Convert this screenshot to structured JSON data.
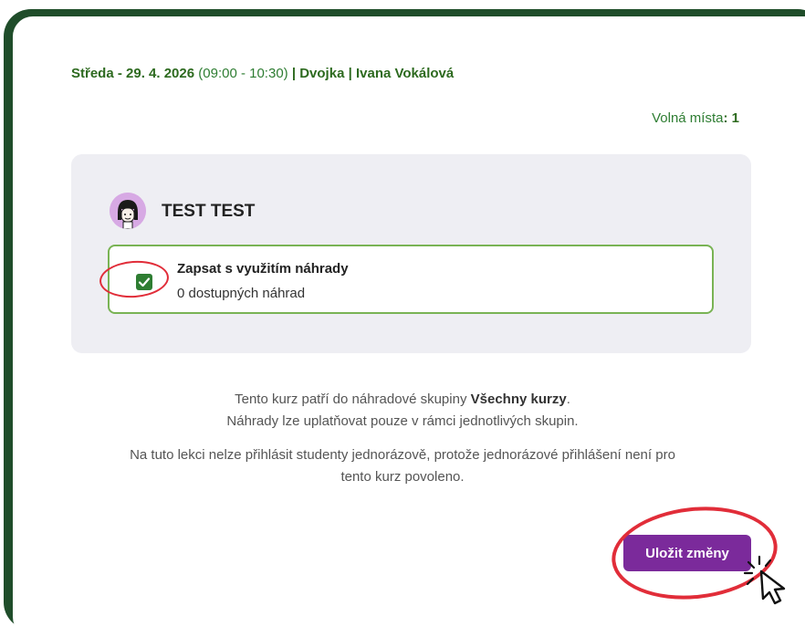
{
  "header": {
    "day_date": "Středa - 29. 4. 2026",
    "time": "(09:00 - 10:30)",
    "separator": "|",
    "group": "Dvojka",
    "teacher": "Ivana Vokálová"
  },
  "spots": {
    "label": "Volná místa",
    "colon": ":",
    "value": "1"
  },
  "student": {
    "name": "TEST TEST",
    "avatar_icon": "avatar-icon"
  },
  "option": {
    "checked": true,
    "title": "Zapsat s využitím náhrady",
    "subtitle": "0 dostupných náhrad",
    "checkbox_icon": "check-icon"
  },
  "info": {
    "line1_prefix": "Tento kurz patří do náhradové skupiny",
    "line1_group": "Všechny kurzy",
    "line1_suffix": ".",
    "line2": "Náhrady lze uplatňovat pouze v rámci jednotlivých skupin.",
    "line3": "Na tuto lekci nelze přihlásit studenty jednorázově, protože jednorázové přihlášení není pro",
    "line4": "tento kurz povoleno."
  },
  "actions": {
    "save_label": "Uložit změny"
  },
  "colors": {
    "frame": "#1f4d2a",
    "accent_green": "#2e7d32",
    "option_border": "#79b354",
    "primary_button": "#7b2a9b",
    "annotation_red": "#e12d39"
  }
}
